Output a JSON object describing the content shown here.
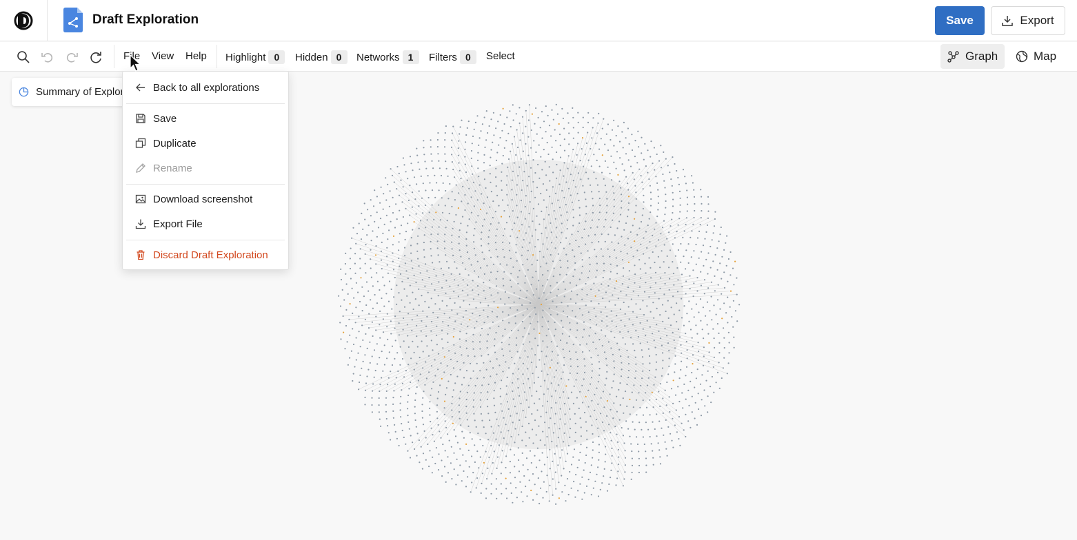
{
  "header": {
    "title": "Draft Exploration",
    "save_label": "Save",
    "export_label": "Export"
  },
  "toolbar": {
    "menus": [
      "File",
      "View",
      "Help"
    ],
    "stats": [
      {
        "label": "Highlight",
        "count": "0"
      },
      {
        "label": "Hidden",
        "count": "0"
      },
      {
        "label": "Networks",
        "count": "1"
      },
      {
        "label": "Filters",
        "count": "0"
      }
    ],
    "select_label": "Select",
    "views": [
      {
        "label": "Graph",
        "active": true
      },
      {
        "label": "Map",
        "active": false
      }
    ]
  },
  "summary": {
    "label": "Summary of Explor"
  },
  "file_menu": {
    "items": [
      {
        "label": "Back to all explorations",
        "icon": "arrow-left-icon",
        "state": "normal"
      },
      {
        "label": "Save",
        "icon": "floppy-icon",
        "state": "normal"
      },
      {
        "label": "Duplicate",
        "icon": "duplicate-icon",
        "state": "normal"
      },
      {
        "label": "Rename",
        "icon": "pencil-icon",
        "state": "disabled"
      },
      {
        "label": "Download screenshot",
        "icon": "image-icon",
        "state": "normal"
      },
      {
        "label": "Export File",
        "icon": "download-icon",
        "state": "normal"
      },
      {
        "label": "Discard Draft Exploration",
        "icon": "trash-icon",
        "state": "danger"
      }
    ]
  },
  "colors": {
    "primary": "#2f6ec3",
    "danger": "#d2471d",
    "node": "#8d99a6",
    "node_highlight": "#e5a23c"
  }
}
